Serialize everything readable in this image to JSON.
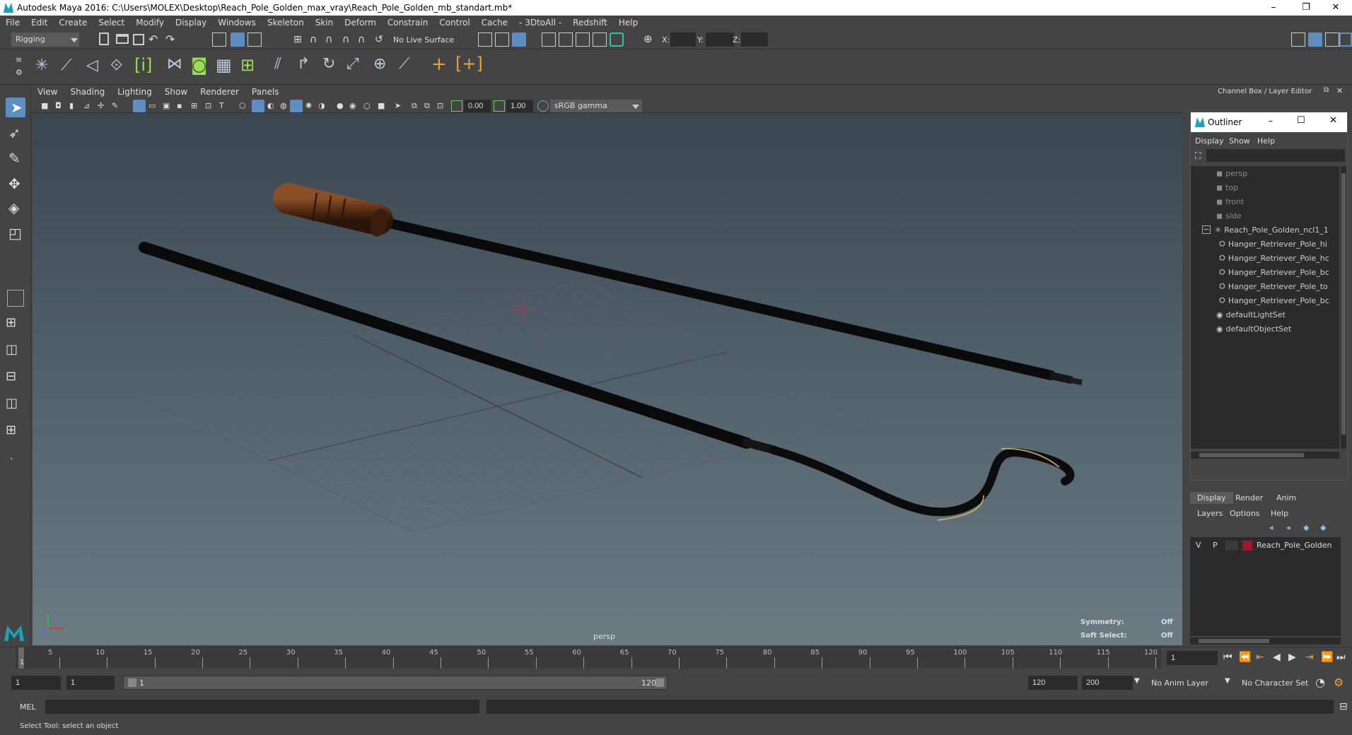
{
  "window": {
    "title": "Autodesk Maya 2016: C:\\Users\\MOLEX\\Desktop\\Reach_Pole_Golden_max_vray\\Reach_Pole_Golden_mb_standart.mb*",
    "minimize": "–",
    "restore": "❐",
    "close": "✕"
  },
  "menubar": [
    "File",
    "Edit",
    "Create",
    "Select",
    "Modify",
    "Display",
    "Windows",
    "Skeleton",
    "Skin",
    "Deform",
    "Constrain",
    "Control",
    "Cache",
    "- 3DtoAll -",
    "Redshift",
    "Help"
  ],
  "statusline": {
    "mode": "Rigging",
    "live_surface": "No Live Surface",
    "x_label": "X:",
    "y_label": "Y:",
    "z_label": "Z:"
  },
  "viewport": {
    "menu": [
      "View",
      "Shading",
      "Lighting",
      "Show",
      "Renderer",
      "Panels"
    ],
    "exposure": "0.00",
    "gamma": "1.00",
    "color_space": "sRGB gamma",
    "camera_label": "persp",
    "symmetry_label": "Symmetry:",
    "symmetry_value": "Off",
    "soft_select_label": "Soft Select:",
    "soft_select_value": "Off"
  },
  "right_panel": {
    "header": "Channel Box / Layer Editor"
  },
  "outliner": {
    "title": "Outliner",
    "menu": [
      "Display",
      "Show",
      "Help"
    ],
    "items": [
      {
        "label": "persp",
        "icon": "camera-icon",
        "indent": 1,
        "dim": true
      },
      {
        "label": "top",
        "icon": "camera-icon",
        "indent": 1,
        "dim": true
      },
      {
        "label": "front",
        "icon": "camera-icon",
        "indent": 1,
        "dim": true
      },
      {
        "label": "side",
        "icon": "camera-icon",
        "indent": 1,
        "dim": true
      },
      {
        "label": "Reach_Pole_Golden_ncl1_1",
        "icon": "group-icon",
        "indent": 1,
        "dim": false
      },
      {
        "label": "Hanger_Retriever_Pole_hi",
        "icon": "mesh-icon",
        "indent": 2,
        "dim": false
      },
      {
        "label": "Hanger_Retriever_Pole_hc",
        "icon": "mesh-icon",
        "indent": 2,
        "dim": false
      },
      {
        "label": "Hanger_Retriever_Pole_bc",
        "icon": "mesh-icon",
        "indent": 2,
        "dim": false
      },
      {
        "label": "Hanger_Retriever_Pole_to",
        "icon": "mesh-icon",
        "indent": 2,
        "dim": false
      },
      {
        "label": "Hanger_Retriever_Pole_bc",
        "icon": "mesh-icon",
        "indent": 2,
        "dim": false
      },
      {
        "label": "defaultLightSet",
        "icon": "set-icon",
        "indent": 1,
        "dim": false
      },
      {
        "label": "defaultObjectSet",
        "icon": "set-icon",
        "indent": 1,
        "dim": false
      }
    ]
  },
  "layer_editor": {
    "tabs": [
      "Display",
      "Render",
      "Anim"
    ],
    "menu": [
      "Layers",
      "Options",
      "Help"
    ],
    "layer": {
      "v": "V",
      "p": "P",
      "name": "Reach_Pole_Golden",
      "color": "#a0162e"
    }
  },
  "timeline": {
    "ticks": [
      "5",
      "10",
      "15",
      "20",
      "25",
      "30",
      "35",
      "40",
      "45",
      "50",
      "55",
      "60",
      "65",
      "70",
      "75",
      "80",
      "85",
      "90",
      "95",
      "100",
      "105",
      "110",
      "115",
      "120"
    ],
    "current_frame": "1",
    "first_tick": "1"
  },
  "range": {
    "start": "1",
    "playback_start": "1",
    "slider_start": "1",
    "slider_end": "120",
    "playback_end": "120",
    "end": "200",
    "anim_layer": "No Anim Layer",
    "character_set": "No Character Set"
  },
  "cmdline": {
    "lang": "MEL"
  },
  "helpline": {
    "text": "Select Tool: select an object"
  }
}
